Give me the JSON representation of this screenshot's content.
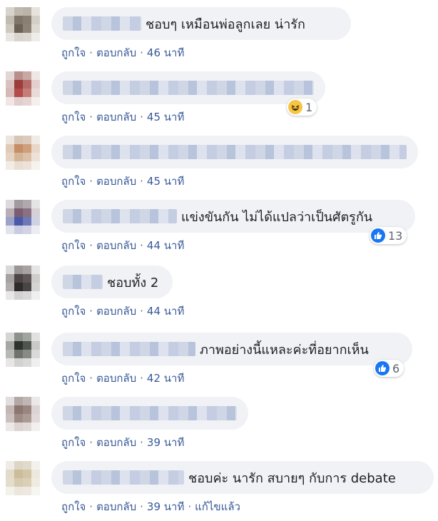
{
  "actions": {
    "like": "ถูกใจ",
    "reply": "ตอบกลับ",
    "dot": "·",
    "edited": "แก้ไขแล้ว"
  },
  "colors": {
    "link": "#385898",
    "meta": "#606770",
    "bubble": "#f0f2f5",
    "like_blue": "#1877f2"
  },
  "comments": [
    {
      "text": "ชอบๆ เหมือนพ่อลูกเลย น่ารัก",
      "time": "46 นาที"
    },
    {
      "text": "",
      "time": "45 นาที",
      "reaction": {
        "icon": "haha-icon",
        "count": "1"
      }
    },
    {
      "text": "",
      "time": "45 นาที"
    },
    {
      "text": "แข่งขันกัน ไม่ได้แปลว่าเป็นศัตรูกัน",
      "time": "44 นาที",
      "reaction": {
        "icon": "like-icon",
        "count": "13"
      }
    },
    {
      "text": "ชอบทั้ง 2",
      "time": "44 นาที"
    },
    {
      "text": "ภาพอย่างนี้แหละค่ะที่อยากเห็น",
      "time": "42 นาที",
      "reaction": {
        "icon": "like-icon",
        "count": "6"
      }
    },
    {
      "text": "",
      "time": "39 นาที"
    },
    {
      "text": "ชอบค่ะ นารัก สบายๆ กับการ debate",
      "time": "39 นาที"
    }
  ]
}
